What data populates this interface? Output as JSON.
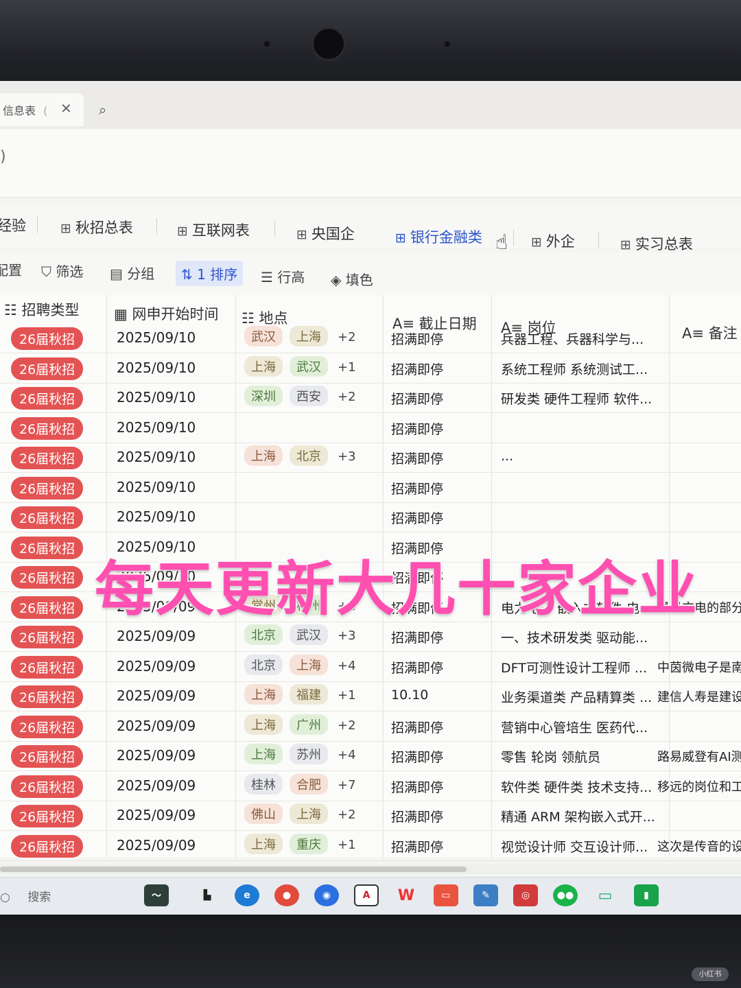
{
  "browser": {
    "tab_title": "信息表",
    "tab_hint": "(",
    "close_glyph": "✕",
    "search_glyph": "⌕",
    "addr_glyph": ")"
  },
  "views": {
    "tabs": [
      {
        "label": "经验"
      },
      {
        "label": "秋招总表"
      },
      {
        "label": "互联网表"
      },
      {
        "label": "央国企"
      },
      {
        "label": "银行金融类"
      },
      {
        "label": "外企"
      },
      {
        "label": "实习总表"
      }
    ],
    "active": "银行金融类"
  },
  "toolbar": {
    "config": "配置",
    "filter": "筛选",
    "group": "分组",
    "sort": "1 排序",
    "row_height": "行高",
    "fill": "填色"
  },
  "columns": {
    "type": "招聘类型",
    "start": "网申开始时间",
    "location": "地点",
    "deadline": "截止日期",
    "position": "岗位",
    "note": "备注"
  },
  "rows": [
    {
      "type": "26届秋招",
      "start": "2025/09/10",
      "loc": [
        "武汉",
        "上海"
      ],
      "more": "+2",
      "deadline": "招满即停",
      "position": "兵器工程、兵器科学与...",
      "note": ""
    },
    {
      "type": "26届秋招",
      "start": "2025/09/10",
      "loc": [
        "上海",
        "武汉"
      ],
      "more": "+1",
      "deadline": "招满即停",
      "position": "系统工程师 系统测试工...",
      "note": ""
    },
    {
      "type": "26届秋招",
      "start": "2025/09/10",
      "loc": [
        "深圳",
        "西安"
      ],
      "more": "+2",
      "deadline": "招满即停",
      "position": "研发类 硬件工程师 软件...",
      "note": ""
    },
    {
      "type": "26届秋招",
      "start": "2025/09/10",
      "loc": [],
      "more": "",
      "deadline": "招满即停",
      "position": "",
      "note": ""
    },
    {
      "type": "26届秋招",
      "start": "2025/09/10",
      "loc": [
        "上海",
        "北京"
      ],
      "more": "+3",
      "deadline": "招满即停",
      "position": "...",
      "note": ""
    },
    {
      "type": "26届秋招",
      "start": "2025/09/10",
      "loc": [],
      "more": "",
      "deadline": "招满即停",
      "position": "",
      "note": ""
    },
    {
      "type": "26届秋招",
      "start": "2025/09/10",
      "loc": [],
      "more": "",
      "deadline": "招满即停",
      "position": "",
      "note": ""
    },
    {
      "type": "26届秋招",
      "start": "2025/09/10",
      "loc": [],
      "more": "",
      "deadline": "招满即停",
      "position": "",
      "note": ""
    },
    {
      "type": "26届秋招",
      "start": "2025/09/10",
      "loc": [],
      "more": "",
      "deadline": "招满即停",
      "position": "",
      "note": ""
    },
    {
      "type": "26届秋招",
      "start": "2025/09/09",
      "loc": [
        "常州",
        "杭州"
      ],
      "more": "+1",
      "deadline": "招满即停",
      "position": "电力电子 嵌入式软件 电...",
      "note": "星星充电的部分"
    },
    {
      "type": "26届秋招",
      "start": "2025/09/09",
      "loc": [
        "北京",
        "武汉"
      ],
      "more": "+3",
      "deadline": "招满即停",
      "position": "一、技术研发类 驱动能...",
      "note": ""
    },
    {
      "type": "26届秋招",
      "start": "2025/09/09",
      "loc": [
        "北京",
        "上海"
      ],
      "more": "+4",
      "deadline": "招满即停",
      "position": "DFT可测性设计工程师 ...",
      "note": "中茵微电子是南"
    },
    {
      "type": "26届秋招",
      "start": "2025/09/09",
      "loc": [
        "上海",
        "福建"
      ],
      "more": "+1",
      "deadline": "10.10",
      "position": "业务渠道类 产品精算类 ...",
      "note": "建信人寿是建设"
    },
    {
      "type": "26届秋招",
      "start": "2025/09/09",
      "loc": [
        "上海",
        "广州"
      ],
      "more": "+2",
      "deadline": "招满即停",
      "position": "营销中心管培生 医药代...",
      "note": ""
    },
    {
      "type": "26届秋招",
      "start": "2025/09/09",
      "loc": [
        "上海",
        "苏州"
      ],
      "more": "+4",
      "deadline": "招满即停",
      "position": "零售 轮岗 领航员",
      "note": "路易威登有AI测"
    },
    {
      "type": "26届秋招",
      "start": "2025/09/09",
      "loc": [
        "桂林",
        "合肥"
      ],
      "more": "+7",
      "deadline": "招满即停",
      "position": "软件类 硬件类 技术支持...",
      "note": "移远的岗位和工作"
    },
    {
      "type": "26届秋招",
      "start": "2025/09/09",
      "loc": [
        "佛山",
        "上海"
      ],
      "more": "+2",
      "deadline": "招满即停",
      "position": "精通 ARM 架构嵌入式开...",
      "note": ""
    },
    {
      "type": "26届秋招",
      "start": "2025/09/09",
      "loc": [
        "上海",
        "重庆"
      ],
      "more": "+1",
      "deadline": "招满即停",
      "position": "视觉设计师 交互设计师...",
      "note": "这次是传音的设计"
    }
  ],
  "overlay_text": "每天更新大几十家企业",
  "taskbar": {
    "search": "搜索"
  },
  "watermark": "小红书"
}
